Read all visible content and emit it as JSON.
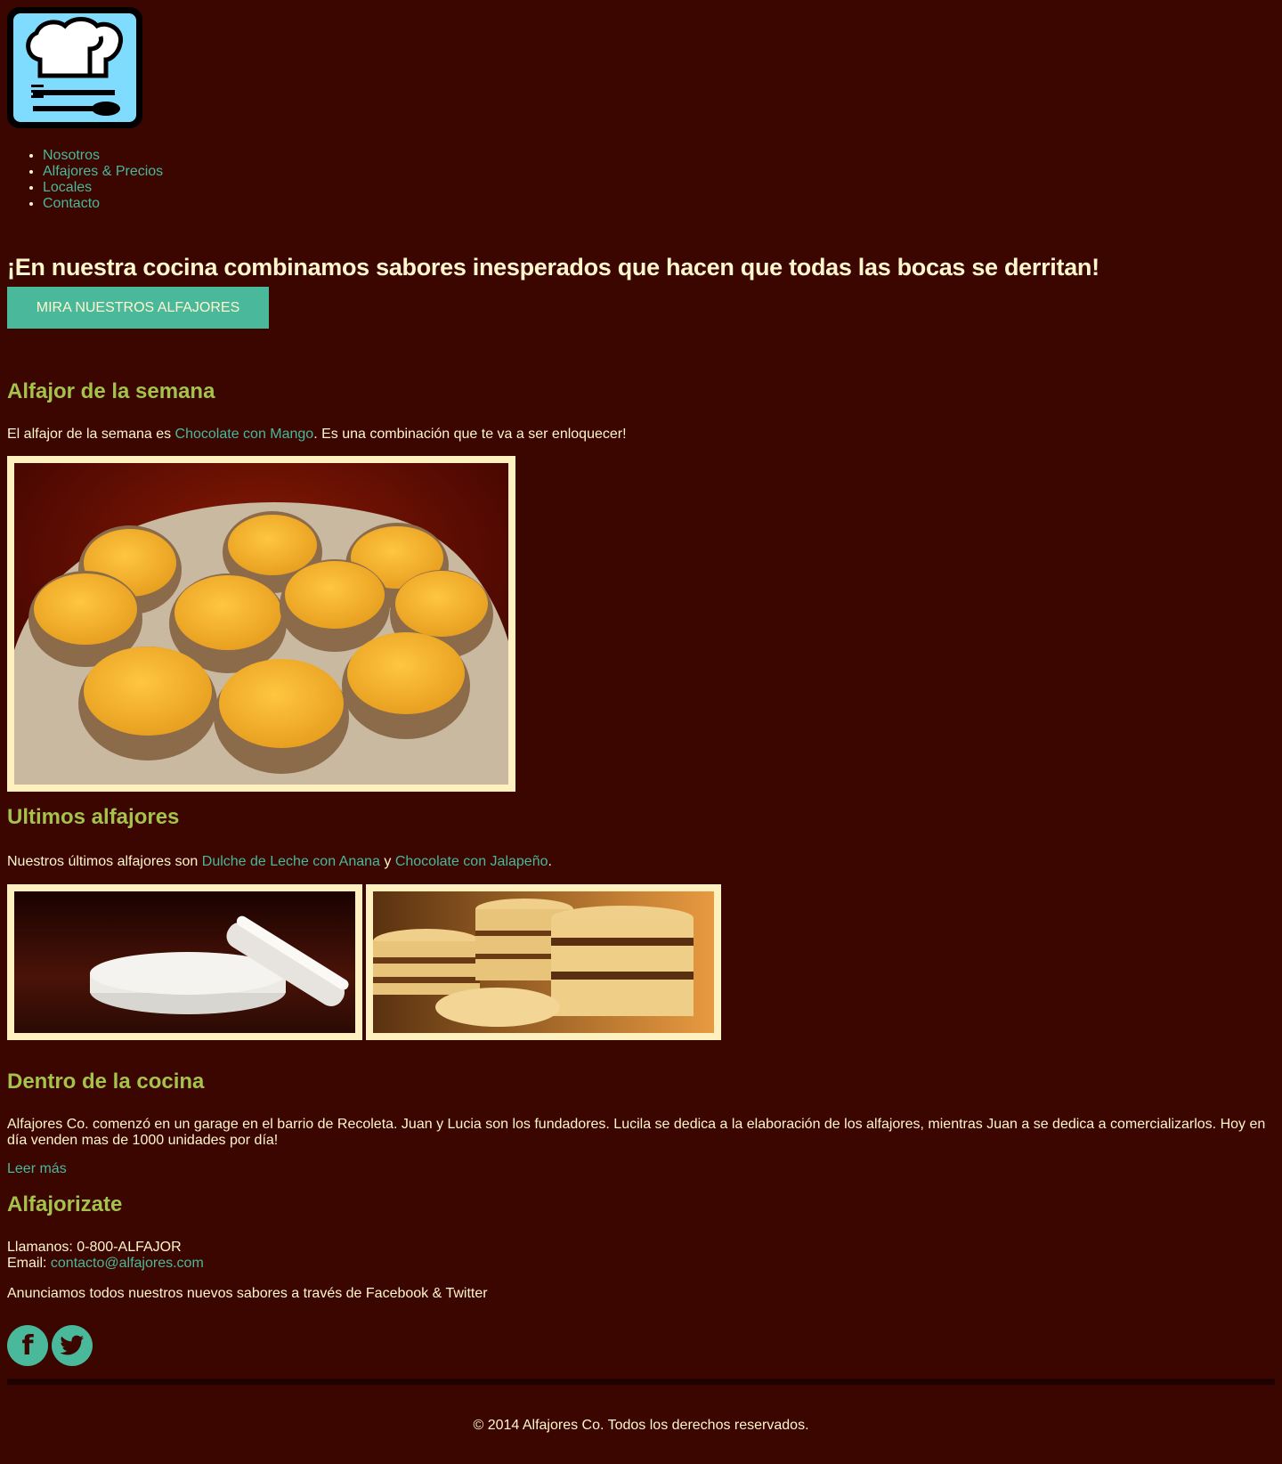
{
  "nav": {
    "items": [
      "Nosotros",
      "Alfajores & Precios",
      "Locales",
      "Contacto"
    ]
  },
  "hero": {
    "headline": "¡En nuestra cocina combinamos sabores inesperados que hacen que todas las bocas se derritan!",
    "button_label": "MIRA NUESTROS ALFAJORES"
  },
  "week": {
    "title": "Alfajor de la semana",
    "text_before": "El alfajor de la semana es ",
    "link": "Chocolate con Mango",
    "text_after": ". Es una combinación que te va a ser enloquecer!"
  },
  "latest": {
    "title": "Ultimos alfajores",
    "text_before": "Nuestros últimos alfajores son ",
    "link1": "Dulche de Leche con Anana",
    "mid": " y ",
    "link2": "Chocolate con Jalapeño",
    "text_after": "."
  },
  "kitchen": {
    "title": "Dentro de la cocina",
    "text": "Alfajores Co. comenzó en un garage en el barrio de Recoleta. Juan y Lucia son los fundadores. Lucila se dedica a la elaboración de los alfajores, mientras Juan a se dedica a comercializarlos. Hoy en día venden mas de 1000 unidades por día!",
    "read_more": "Leer más"
  },
  "contact": {
    "title": "Alfajorizate",
    "phone": "Llamanos: 0-800-ALFAJOR",
    "email_label": "Email: ",
    "email": "contacto@alfajores.com",
    "social_text": "Anunciamos todos nuestros nuevos sabores a través de Facebook & Twitter"
  },
  "footer": {
    "text": "© 2014 Alfajores Co. Todos los derechos reservados."
  },
  "colors": {
    "background": "#3b0500",
    "accent": "#4ab89a",
    "heading": "#a5c24a",
    "text": "#fff6cc"
  }
}
